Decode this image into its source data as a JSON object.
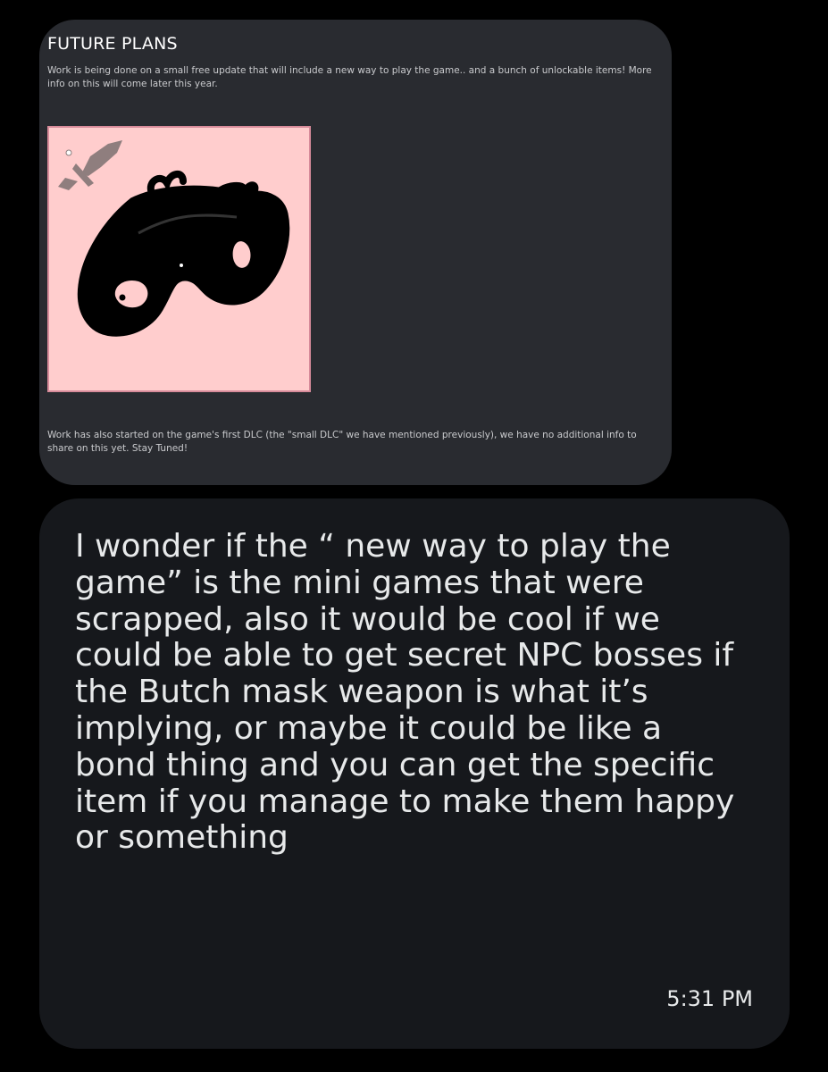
{
  "post": {
    "title": "FUTURE PLANS",
    "paragraph_1": "Work is being done on a small free update that will include a new way to play the game.. and a bunch of unlockable items! More info on this will come later this year.",
    "image": {
      "background_color": "#ffcdcd",
      "border_color": "#d78b9a",
      "subjects": [
        "mask-icon",
        "dagger-icon"
      ]
    },
    "paragraph_2": "Work has also started on the game's first DLC (the \"small DLC\" we have mentioned previously), we have no additional info to share on this yet. Stay Tuned!"
  },
  "message": {
    "text": "I wonder if the “ new way to play the game” is the mini games that were scrapped, also it would be cool if we could be able to get secret NPC bosses if the Butch mask weapon is what it’s implying, or maybe it could be like a bond thing and you can get the specific item if you manage to make them happy or something",
    "timestamp": "5:31 PM"
  },
  "colors": {
    "background": "#000000",
    "post_bubble": "#292b30",
    "message_bubble": "#16181c",
    "message_text": "#e7e9ea"
  }
}
